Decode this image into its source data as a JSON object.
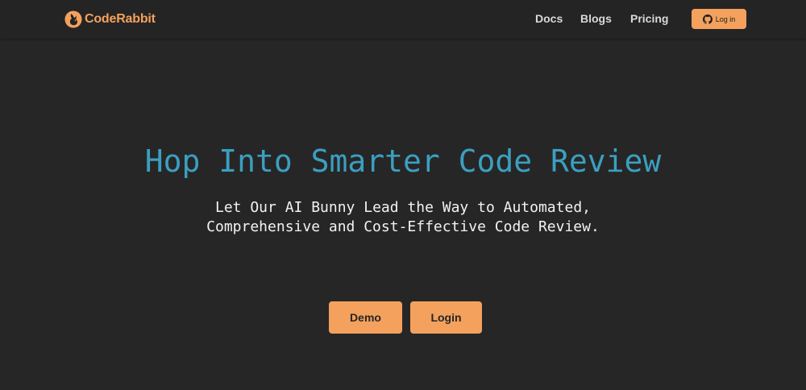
{
  "colors": {
    "background": "#262626",
    "accent": "#F4A15D",
    "headline": "#3B9FC0",
    "nav_text": "#D9D9D9",
    "subtitle": "#F2F2F2"
  },
  "header": {
    "brand": {
      "icon": "rabbit-logo-icon",
      "name": "CodeRabbit"
    },
    "nav": [
      {
        "label": "Docs"
      },
      {
        "label": "Blogs"
      },
      {
        "label": "Pricing"
      }
    ],
    "login_button": {
      "icon": "github-icon",
      "label": "Log in"
    }
  },
  "hero": {
    "headline": "Hop Into Smarter Code Review",
    "subtitle_lines": [
      "Let Our AI Bunny Lead the Way to Automated,",
      "Comprehensive and Cost-Effective Code Review."
    ],
    "buttons": [
      {
        "label": "Demo"
      },
      {
        "label": "Login"
      }
    ]
  }
}
